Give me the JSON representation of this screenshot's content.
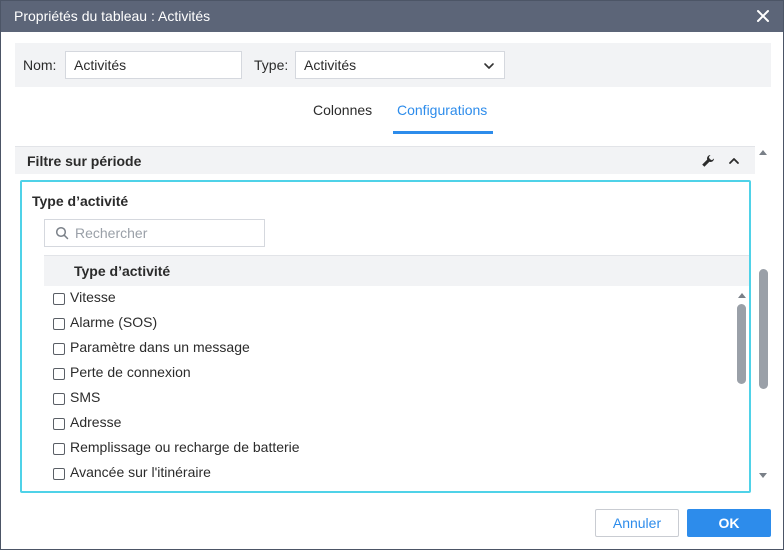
{
  "window": {
    "title": "Propriétés du tableau : Activités"
  },
  "form": {
    "name_label": "Nom:",
    "name_value": "Activités",
    "type_label": "Type:",
    "type_value": "Activités"
  },
  "tabs": [
    {
      "label": "Colonnes",
      "active": false
    },
    {
      "label": "Configurations",
      "active": true
    }
  ],
  "section": {
    "title": "Filtre sur période"
  },
  "filter": {
    "title": "Type d’activité",
    "search_placeholder": "Rechercher",
    "column_header": "Type d’activité",
    "items": [
      {
        "label": "Vitesse",
        "checked": false
      },
      {
        "label": "Alarme (SOS)",
        "checked": false
      },
      {
        "label": "Paramètre dans un message",
        "checked": false
      },
      {
        "label": "Perte de connexion",
        "checked": false
      },
      {
        "label": "SMS",
        "checked": false
      },
      {
        "label": "Adresse",
        "checked": false
      },
      {
        "label": "Remplissage ou recharge de batterie",
        "checked": false
      },
      {
        "label": "Avancée sur l'itinéraire",
        "checked": false
      }
    ]
  },
  "footer": {
    "cancel_label": "Annuler",
    "ok_label": "OK"
  },
  "colors": {
    "accent": "#2d8ceb",
    "titlebar": "#5c6578",
    "focus_border": "#4fd2e8"
  },
  "icons": [
    "close-icon",
    "chevron-down-icon",
    "wrench-icon",
    "chevron-up-icon",
    "search-icon",
    "scroll-up-icon",
    "scroll-down-icon"
  ]
}
